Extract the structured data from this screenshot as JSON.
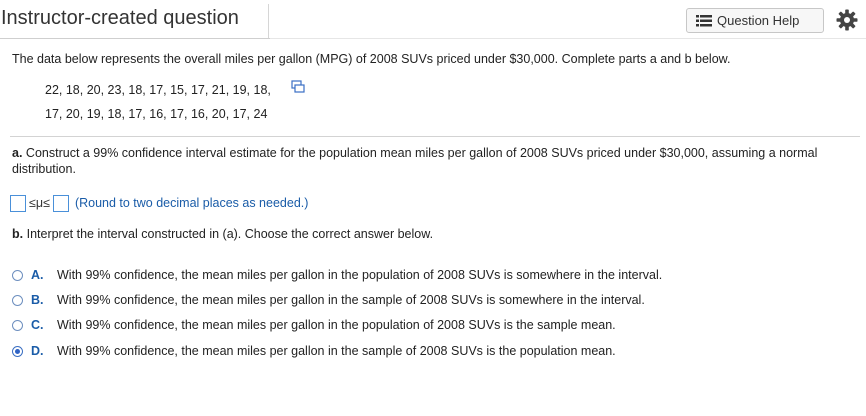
{
  "header": {
    "title": "Instructor-created question",
    "help_label": "Question Help",
    "help_icon": "list-icon",
    "settings_icon": "gear-icon"
  },
  "question": {
    "intro": "The data below represents the overall miles per gallon (MPG) of 2008 SUVs priced under $30,000. Complete parts a and b below.",
    "data_line_1": "22, 18, 20, 23, 18, 17, 15, 17, 21, 19, 18,",
    "data_line_2": "17, 20, 19, 18, 17, 16, 17, 16, 20, 17, 24",
    "part_a": "Construct a 99% confidence interval estimate for the population mean miles per gallon of 2008 SUVs priced under $30,000, assuming a normal distribution.",
    "part_a_label": "a.",
    "answer_symbol": "≤μ≤",
    "answer_hint": "(Round to two decimal places as needed.)",
    "part_b_label": "b.",
    "part_b": "Interpret the interval constructed in (a).  Choose the correct answer below.",
    "options": [
      {
        "letter": "A.",
        "text": "With 99% confidence, the mean miles per gallon in the population of 2008 SUVs is somewhere in the interval.",
        "selected": false
      },
      {
        "letter": "B.",
        "text": "With 99% confidence, the mean miles per gallon in the sample of 2008 SUVs is somewhere in the interval.",
        "selected": false
      },
      {
        "letter": "C.",
        "text": "With 99% confidence, the mean miles per gallon in the population of 2008 SUVs is the sample mean.",
        "selected": false
      },
      {
        "letter": "D.",
        "text": "With 99% confidence, the mean miles per gallon in the sample of 2008 SUVs is the population mean.",
        "selected": true
      }
    ]
  }
}
